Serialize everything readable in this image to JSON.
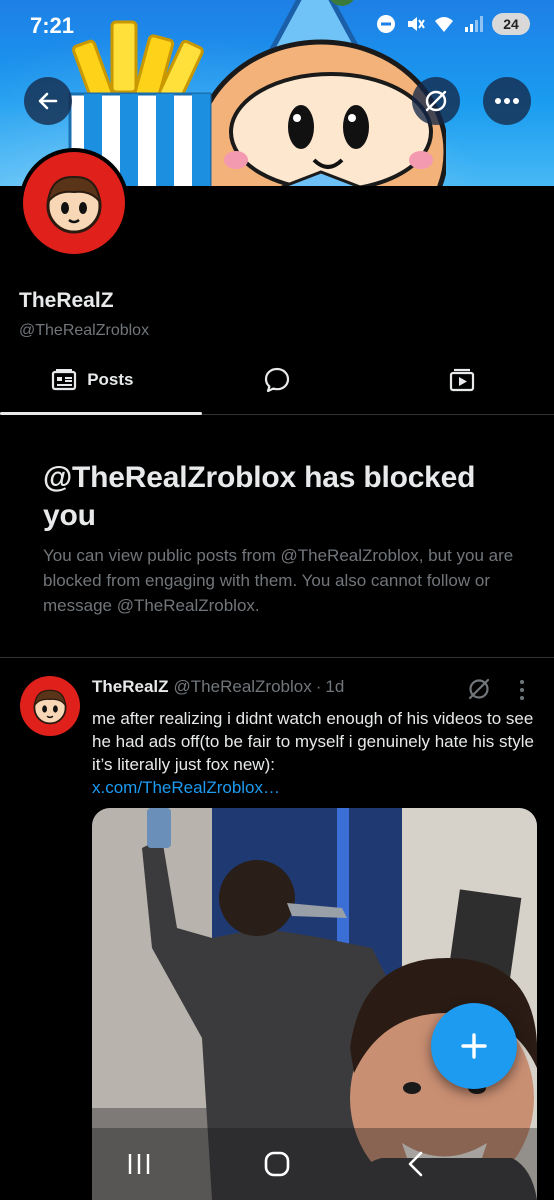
{
  "status_bar": {
    "time": "7:21",
    "battery": "24"
  },
  "profile": {
    "display_name": "TheRealZ",
    "handle": "@TheRealZroblox"
  },
  "tabs": [
    {
      "label": "Posts",
      "icon": "posts-icon",
      "active": true
    },
    {
      "label": "",
      "icon": "replies-icon",
      "active": false
    },
    {
      "label": "",
      "icon": "media-icon",
      "active": false
    }
  ],
  "blocked": {
    "title": "@TheRealZroblox has blocked you",
    "description": "You can view public posts from @TheRealZroblox, but you are blocked from engaging with them. You also cannot follow or message @TheRealZroblox."
  },
  "post": {
    "name": "TheRealZ",
    "handle": "@TheRealZroblox",
    "separator": "·",
    "time": "1d",
    "text": "me after realizing i didnt watch enough of his videos to see he had ads off(to be fair to myself i genuinely hate his style it’s literally just fox new):",
    "link": "x.com/TheRealZroblox…"
  },
  "colors": {
    "accent": "#1d9bf0",
    "background": "#000000",
    "text_primary": "#e7e9ea",
    "text_secondary": "#71767b",
    "avatar_red": "#e0201a"
  }
}
